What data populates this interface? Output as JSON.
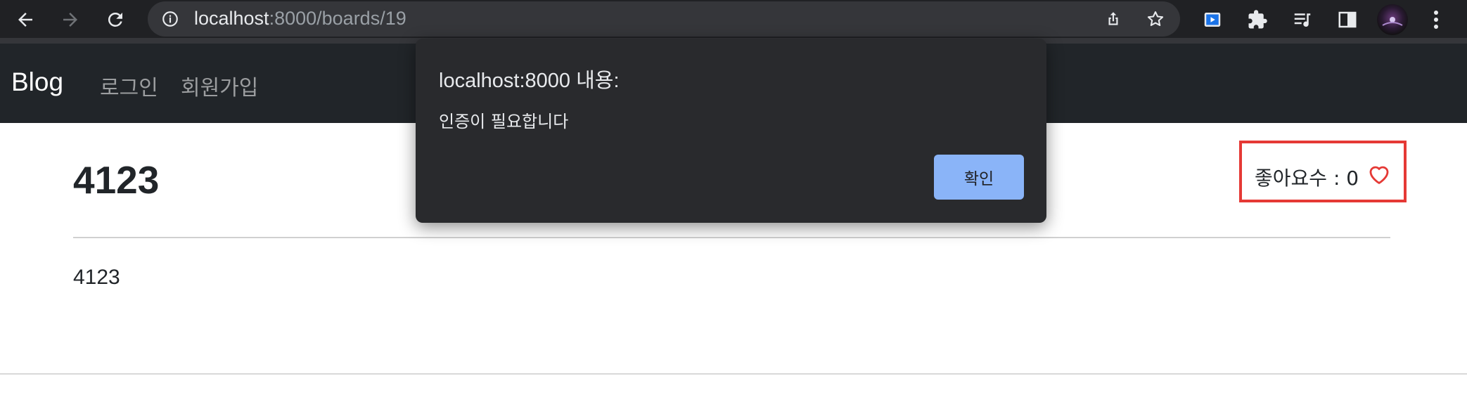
{
  "browser": {
    "url_host": "localhost",
    "url_path": ":8000/boards/19"
  },
  "navbar": {
    "brand": "Blog",
    "links": [
      "로그인",
      "회원가입"
    ]
  },
  "post": {
    "title": "4123",
    "body": "4123",
    "like_label": "좋아요수 : 0"
  },
  "dialog": {
    "title": "localhost:8000 내용:",
    "message": "인증이 필요합니다",
    "ok_label": "확인"
  },
  "colors": {
    "chrome_bg": "#202124",
    "navbar_bg": "#212529",
    "dialog_bg": "#292a2d",
    "ok_button": "#8ab4f8",
    "highlight_border": "#e53935"
  }
}
